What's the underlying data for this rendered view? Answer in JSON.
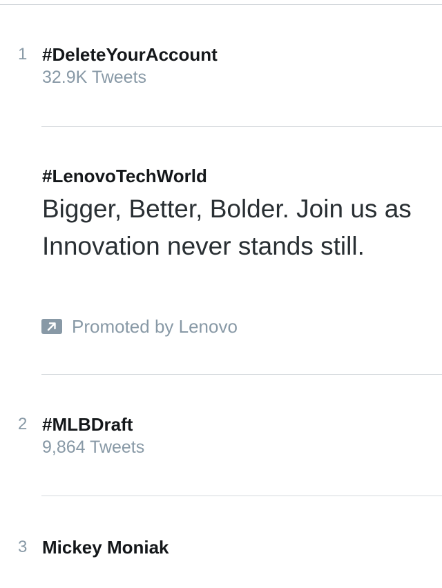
{
  "trends": [
    {
      "rank": "1",
      "name": "#DeleteYourAccount",
      "meta": "32.9K Tweets"
    },
    {
      "rank": "2",
      "name": "#MLBDraft",
      "meta": "9,864 Tweets"
    },
    {
      "rank": "3",
      "name": "Mickey Moniak"
    }
  ],
  "promoted": {
    "name": "#LenovoTechWorld",
    "description": "Bigger, Better, Bolder. Join us as Innovation never stands still.",
    "label": "Promoted by Lenovo",
    "icon": "promoted-arrow-icon"
  },
  "colors": {
    "primary_text": "#14171a",
    "secondary_text": "#8899a6",
    "divider": "#d4d8dc"
  }
}
